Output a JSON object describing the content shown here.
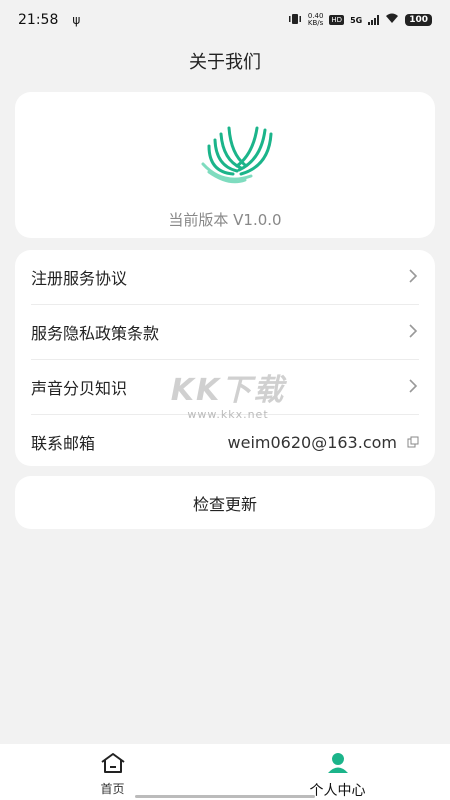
{
  "status_bar": {
    "time": "21:58",
    "usb": "ψ",
    "net_speed_value": "0.40",
    "net_speed_unit": "KB/s",
    "hd": "HD",
    "network": "5G",
    "battery": "100"
  },
  "page": {
    "title": "关于我们"
  },
  "about": {
    "version_label": "当前版本 V1.0.0"
  },
  "menu": {
    "items": [
      {
        "label": "注册服务协议"
      },
      {
        "label": "服务隐私政策条款"
      },
      {
        "label": "声音分贝知识"
      }
    ],
    "contact": {
      "label": "联系邮箱",
      "email": "weim0620@163.com"
    }
  },
  "update": {
    "label": "检查更新"
  },
  "watermark": {
    "brand": "KK下载",
    "url": "www.kkx.net"
  },
  "tabbar": {
    "home_label": "首页",
    "profile_label": "个人中心"
  },
  "colors": {
    "brand_green": "#1bb48a",
    "background": "#f2f2f2",
    "card": "#ffffff"
  }
}
